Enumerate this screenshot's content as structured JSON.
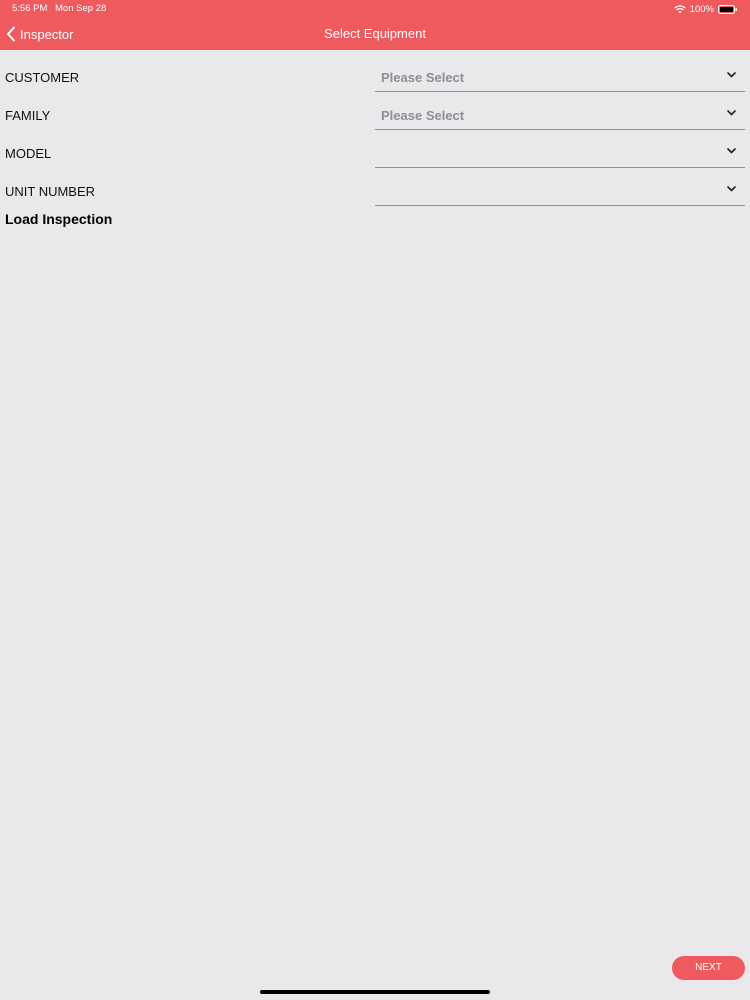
{
  "status_bar": {
    "time": "5:56 PM",
    "date": "Mon Sep 28",
    "battery": "100%",
    "wifi_icon": "wifi-icon",
    "battery_icon": "battery-icon"
  },
  "nav": {
    "back_label": "Inspector",
    "back_icon": "chevron-left-icon",
    "title": "Select Equipment"
  },
  "form": {
    "fields": [
      {
        "label": "CUSTOMER",
        "value": "Please Select"
      },
      {
        "label": "FAMILY",
        "value": "Please Select"
      },
      {
        "label": "MODEL",
        "value": ""
      },
      {
        "label": "UNIT NUMBER",
        "value": ""
      }
    ]
  },
  "load_inspection_label": "Load Inspection",
  "footer": {
    "next_label": "NEXT"
  },
  "colors": {
    "accent": "#ee5a5d",
    "background": "#e9e8ea",
    "placeholder": "#8e8e93"
  }
}
